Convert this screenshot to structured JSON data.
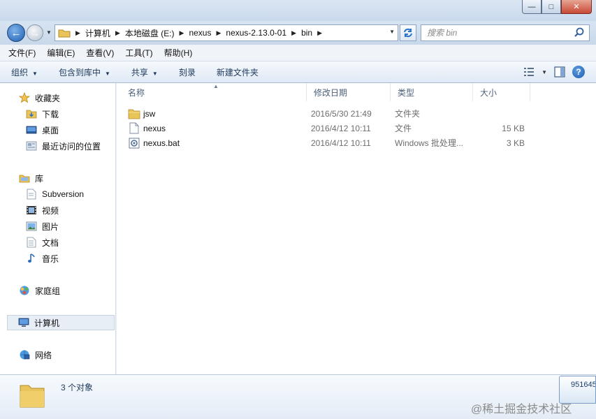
{
  "window": {
    "caption_buttons": {
      "minimize": "—",
      "maximize": "□",
      "close": "✕"
    }
  },
  "address_bar": {
    "crumbs": [
      "计算机",
      "本地磁盘 (E:)",
      "nexus",
      "nexus-2.13.0-01",
      "bin"
    ]
  },
  "search": {
    "placeholder": "搜索 bin"
  },
  "menubar": {
    "items": [
      "文件(F)",
      "编辑(E)",
      "查看(V)",
      "工具(T)",
      "帮助(H)"
    ]
  },
  "commandbar": {
    "organize": "组织",
    "include_library": "包含到库中",
    "share": "共享",
    "burn": "刻录",
    "new_folder": "新建文件夹"
  },
  "navpane": {
    "favorites": "收藏夹",
    "downloads": "下载",
    "desktop": "桌面",
    "recent": "最近访问的位置",
    "libraries": "库",
    "subversion": "Subversion",
    "videos": "视频",
    "pictures": "图片",
    "documents": "文档",
    "music": "音乐",
    "homegroup": "家庭组",
    "computer": "计算机",
    "network": "网络"
  },
  "columns": {
    "name": "名称",
    "date": "修改日期",
    "type": "类型",
    "size": "大小"
  },
  "files": [
    {
      "name": "jsw",
      "date": "2016/5/30 21:49",
      "type": "文件夹",
      "size": "",
      "icon": "folder-icon"
    },
    {
      "name": "nexus",
      "date": "2016/4/12 10:11",
      "type": "文件",
      "size": "15 KB",
      "icon": "file-icon"
    },
    {
      "name": "nexus.bat",
      "date": "2016/4/12 10:11",
      "type": "Windows 批处理...",
      "size": "3 KB",
      "icon": "batch-file-icon"
    }
  ],
  "details": {
    "count": "3 个对象"
  },
  "tray": {
    "text": "951645"
  },
  "watermark": "@稀土掘金技术社区"
}
